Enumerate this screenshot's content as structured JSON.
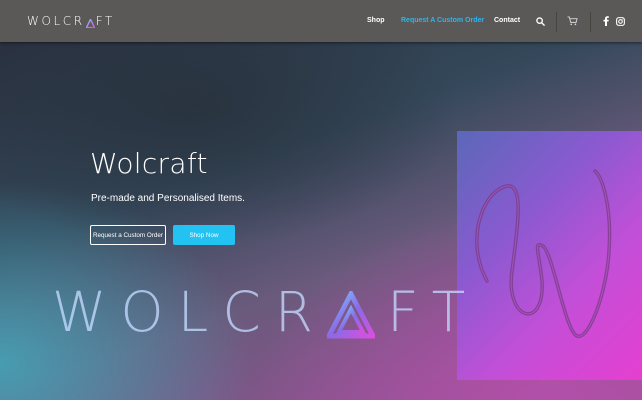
{
  "header": {
    "logo_prefix": "WOLCR",
    "logo_suffix": "FT",
    "nav": [
      {
        "label": "Shop"
      },
      {
        "label": "Request A Custom Order",
        "active": true
      },
      {
        "label": "Contact"
      }
    ],
    "icons": [
      "search-icon",
      "cart-icon",
      "facebook-icon",
      "instagram-icon"
    ]
  },
  "hero": {
    "title": "Wolcraft",
    "subtitle": "Pre-made and Personalised Items.",
    "button_outline_label": "Request a Custom Order",
    "button_fill_label": "Shop Now",
    "big_word_prefix": "WOLCR",
    "big_word_suffix": "FT"
  },
  "colors": {
    "header_bg": "#5b5957",
    "accent": "#2ab7f0",
    "button_fill": "#22c3f2",
    "art_gradient_start": "#5a68b8",
    "art_gradient_end": "#e63fd0"
  }
}
